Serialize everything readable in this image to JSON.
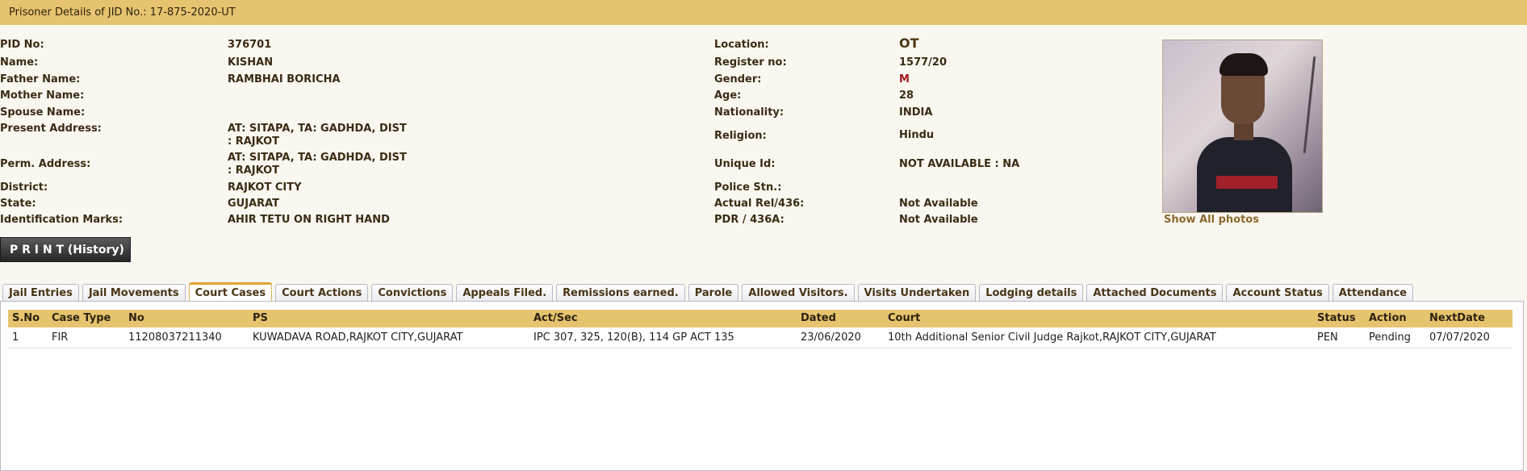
{
  "header": {
    "title": "Prisoner Details of JID No.: 17-875-2020-UT"
  },
  "details_left": [
    {
      "label": "PID No:",
      "value": "376701"
    },
    {
      "label": "Name:",
      "value": "KISHAN"
    },
    {
      "label": "Father Name:",
      "value": "RAMBHAI BORICHA"
    },
    {
      "label": "Mother Name:",
      "value": ""
    },
    {
      "label": "Spouse Name:",
      "value": ""
    },
    {
      "label": "Present Address:",
      "value": "AT: SITAPA, TA: GADHDA, DIST : RAJKOT"
    },
    {
      "label": "Perm. Address:",
      "value": "AT: SITAPA, TA: GADHDA, DIST : RAJKOT"
    },
    {
      "label": "District:",
      "value": "RAJKOT CITY"
    },
    {
      "label": "State:",
      "value": "GUJARAT"
    },
    {
      "label": "Identification Marks:",
      "value": "AHIR TETU ON RIGHT HAND"
    }
  ],
  "details_right": [
    {
      "label": "Location:",
      "value": "OT"
    },
    {
      "label": "Register no:",
      "value": "1577/20"
    },
    {
      "label": "Gender:",
      "value": "M"
    },
    {
      "label": "Age:",
      "value": "28"
    },
    {
      "label": "Nationality:",
      "value": "INDIA"
    },
    {
      "label": "Religion:",
      "value": "Hindu"
    },
    {
      "label": "Unique Id:",
      "value": "NOT AVAILABLE : NA"
    },
    {
      "label": "Police Stn.:",
      "value": ""
    },
    {
      "label": "Actual Rel/436:",
      "value": "Not Available"
    },
    {
      "label": "PDR / 436A:",
      "value": "Not Available"
    }
  ],
  "photo": {
    "show_all_label": "Show All photos"
  },
  "print_button": {
    "label": "P R I N T (History)"
  },
  "tabs": [
    {
      "label": "Jail Entries",
      "active": false
    },
    {
      "label": "Jail Movements",
      "active": false
    },
    {
      "label": "Court Cases",
      "active": true
    },
    {
      "label": "Court Actions",
      "active": false
    },
    {
      "label": "Convictions",
      "active": false
    },
    {
      "label": "Appeals Filed.",
      "active": false
    },
    {
      "label": "Remissions earned.",
      "active": false
    },
    {
      "label": "Parole",
      "active": false
    },
    {
      "label": "Allowed Visitors.",
      "active": false
    },
    {
      "label": "Visits Undertaken",
      "active": false
    },
    {
      "label": "Lodging details",
      "active": false
    },
    {
      "label": "Attached Documents",
      "active": false
    },
    {
      "label": "Account Status",
      "active": false
    },
    {
      "label": "Attendance",
      "active": false
    }
  ],
  "court_cases": {
    "columns": [
      "S.No",
      "Case Type",
      "No",
      "PS",
      "Act/Sec",
      "Dated",
      "Court",
      "Status",
      "Action",
      "NextDate"
    ],
    "rows": [
      [
        "1",
        "FIR",
        "11208037211340",
        "KUWADAVA ROAD,RAJKOT CITY,GUJARAT",
        "IPC 307, 325, 120(B), 114 GP ACT 135",
        "23/06/2020",
        "10th Additional Senior Civil Judge Rajkot,RAJKOT CITY,GUJARAT",
        "PEN",
        "Pending",
        "07/07/2020"
      ]
    ]
  },
  "colors": {
    "header_bar": "#e6c46f",
    "page_background": "#faf7f0",
    "label_text": "#3a2c14",
    "gender_value": "#a3161a",
    "active_tab_accent": "#e0a234"
  }
}
